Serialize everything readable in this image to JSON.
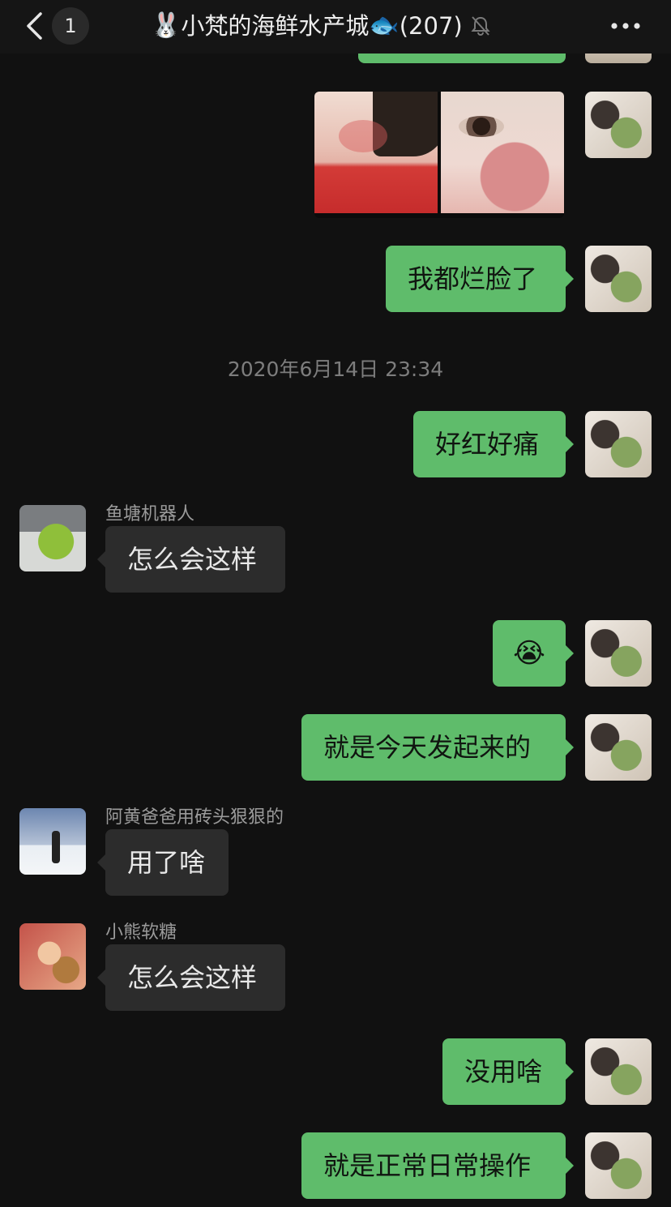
{
  "header": {
    "unread_count": "1",
    "title_prefix_emoji": "🐰",
    "title": "小梵的海鲜水产城",
    "title_suffix_emoji": "🐟",
    "member_count": "(207)",
    "muted": true
  },
  "messages": {
    "m1": {
      "direction": "out",
      "type": "image"
    },
    "m2": {
      "direction": "out",
      "text": "我都烂脸了"
    },
    "timestamp": "2020年6月14日 23:34",
    "m3": {
      "direction": "out",
      "text": "好红好痛"
    },
    "m4": {
      "direction": "in",
      "sender": "鱼塘机器人",
      "text": "怎么会这样"
    },
    "m5": {
      "direction": "out",
      "text": "😭"
    },
    "m6": {
      "direction": "out",
      "text": "就是今天发起来的"
    },
    "m7": {
      "direction": "in",
      "sender": "阿黄爸爸用砖头狠狠的",
      "text": "用了啥"
    },
    "m8": {
      "direction": "in",
      "sender": "小熊软糖",
      "text": "怎么会这样"
    },
    "m9": {
      "direction": "out",
      "text": "没用啥"
    },
    "m10": {
      "direction": "out",
      "text": "就是正常日常操作"
    }
  },
  "colors": {
    "background": "#111111",
    "outgoing_bubble": "#5fbc6b",
    "incoming_bubble": "#2c2c2c",
    "timestamp": "#7d7d7d"
  }
}
